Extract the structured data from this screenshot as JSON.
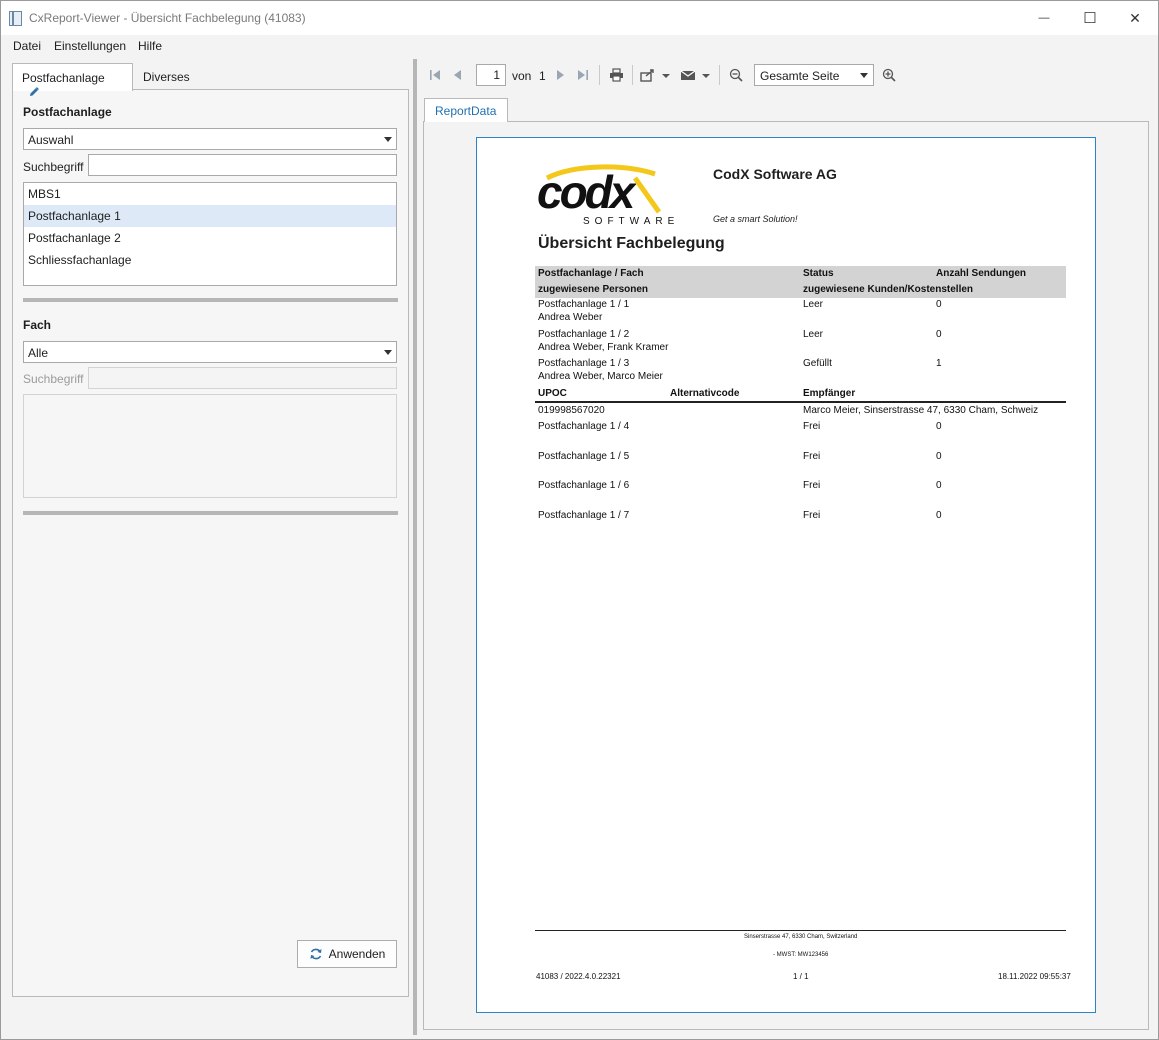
{
  "window": {
    "title": "CxReport-Viewer - Übersicht Fachbelegung (41083)",
    "minimize_glyph": "—",
    "maximize_glyph": "☐",
    "close_glyph": "✕"
  },
  "menu": [
    "Datei",
    "Einstellungen",
    "Hilfe"
  ],
  "left": {
    "tabs": [
      "Postfachanlage",
      "Diverses"
    ],
    "postfach": {
      "label": "Postfachanlage",
      "combo_value": "Auswahl",
      "search_label": "Suchbegriff",
      "search_value": "",
      "items": [
        "MBS1",
        "Postfachanlage 1",
        "Postfachanlage 2",
        "Schliessfachanlage"
      ],
      "selected_index": 1
    },
    "fach": {
      "label": "Fach",
      "combo_value": "Alle",
      "search_label": "Suchbegriff",
      "search_value": ""
    },
    "apply_label": "Anwenden"
  },
  "toolbar": {
    "page_number": "1",
    "of_label": "von",
    "page_count": "1",
    "zoom_value": "Gesamte Seite",
    "icons": [
      "first-page-icon",
      "prev-page-icon",
      "next-page-icon",
      "last-page-icon",
      "print-icon",
      "export-icon",
      "mail-icon",
      "zoom-out-icon",
      "zoom-in-icon"
    ]
  },
  "report_tab": "ReportData",
  "report": {
    "logo_text": "codx",
    "logo_sub": "SOFTWARE",
    "company": "CodX Software AG",
    "slogan": "Get a smart Solution!",
    "title": "Übersicht Fachbelegung",
    "header": {
      "col1_line1": "Postfachanlage / Fach",
      "col1_line2": "zugewiesene Personen",
      "col2_line1": "Status",
      "col2_line2": "zugewiesene Kunden/Kostenstellen",
      "col3_line1": "Anzahl Sendungen"
    },
    "rows": [
      {
        "fach": "Postfachanlage 1 / 1",
        "personen": "Andrea Weber",
        "status": "Leer",
        "anzahl": "0"
      },
      {
        "fach": "Postfachanlage 1 / 2",
        "personen": "Andrea Weber, Frank Kramer",
        "status": "Leer",
        "anzahl": "0"
      },
      {
        "fach": "Postfachanlage 1 / 3",
        "personen": "Andrea Weber, Marco Meier",
        "status": "Gefüllt",
        "anzahl": "1"
      }
    ],
    "sub_header": {
      "upoc": "UPOC",
      "alt": "Alternativcode",
      "empf": "Empfänger"
    },
    "sub_row": {
      "upoc": "019998567020",
      "alt": "",
      "empf": "Marco Meier, Sinserstrasse 47, 6330 Cham, Schweiz"
    },
    "rows2": [
      {
        "fach": "Postfachanlage 1 / 4",
        "status": "Frei",
        "anzahl": "0"
      },
      {
        "fach": "Postfachanlage 1 / 5",
        "status": "Frei",
        "anzahl": "0"
      },
      {
        "fach": "Postfachanlage 1 / 6",
        "status": "Frei",
        "anzahl": "0"
      },
      {
        "fach": "Postfachanlage 1 / 7",
        "status": "Frei",
        "anzahl": "0"
      }
    ],
    "footer": {
      "address": "Sinserstrasse 47,  6330 Cham,  Switzerland",
      "vat": "- MWST: MW123456",
      "version": "41083 / 2022.4.0.22321",
      "page": "1 / 1",
      "timestamp": "18.11.2022 09:55:37"
    }
  }
}
